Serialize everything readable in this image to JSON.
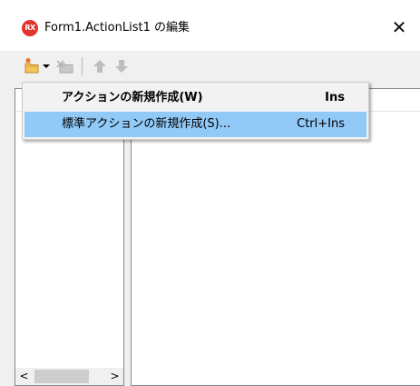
{
  "window": {
    "title": "Form1.ActionList1 の編集",
    "app_icon_text": "RX",
    "close_glyph": "✕",
    "accent_color": "#e0342f"
  },
  "toolbar": {
    "buttons": [
      {
        "name": "new-action",
        "icon": "new-action-icon"
      },
      {
        "name": "new-dropdown",
        "icon": "chevron-down-icon"
      },
      {
        "name": "delete-action",
        "icon": "delete-action-icon"
      },
      {
        "name": "move-up",
        "icon": "arrow-up-icon"
      },
      {
        "name": "move-down",
        "icon": "arrow-down-icon"
      }
    ]
  },
  "menu": {
    "items": [
      {
        "label": "アクションの新規作成(W)",
        "shortcut": "Ins",
        "default": true
      },
      {
        "label": "標準アクションの新規作成(S)...",
        "shortcut": "Ctrl+Ins",
        "highlighted": true
      }
    ],
    "highlight_color": "#91c9f7"
  },
  "scrollbar": {
    "left_arrow": "<",
    "right_arrow": ">"
  }
}
